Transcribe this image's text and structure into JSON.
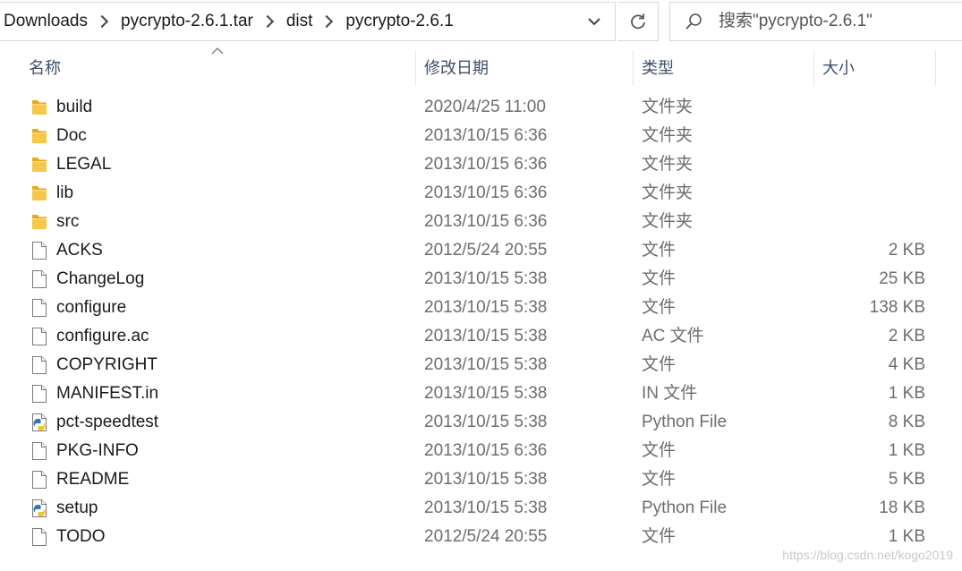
{
  "breadcrumb": [
    "Downloads",
    "pycrypto-2.6.1.tar",
    "dist",
    "pycrypto-2.6.1"
  ],
  "search": {
    "placeholder": "搜索\"pycrypto-2.6.1\""
  },
  "columns": {
    "name": "名称",
    "date": "修改日期",
    "type": "类型",
    "size": "大小"
  },
  "files": [
    {
      "name": "build",
      "date": "2020/4/25 11:00",
      "type": "文件夹",
      "size": "",
      "icon": "folder-icon"
    },
    {
      "name": "Doc",
      "date": "2013/10/15 6:36",
      "type": "文件夹",
      "size": "",
      "icon": "folder-icon"
    },
    {
      "name": "LEGAL",
      "date": "2013/10/15 6:36",
      "type": "文件夹",
      "size": "",
      "icon": "folder-icon"
    },
    {
      "name": "lib",
      "date": "2013/10/15 6:36",
      "type": "文件夹",
      "size": "",
      "icon": "folder-icon"
    },
    {
      "name": "src",
      "date": "2013/10/15 6:36",
      "type": "文件夹",
      "size": "",
      "icon": "folder-icon"
    },
    {
      "name": "ACKS",
      "date": "2012/5/24 20:55",
      "type": "文件",
      "size": "2 KB",
      "icon": "file-icon"
    },
    {
      "name": "ChangeLog",
      "date": "2013/10/15 5:38",
      "type": "文件",
      "size": "25 KB",
      "icon": "file-icon"
    },
    {
      "name": "configure",
      "date": "2013/10/15 5:38",
      "type": "文件",
      "size": "138 KB",
      "icon": "file-icon"
    },
    {
      "name": "configure.ac",
      "date": "2013/10/15 5:38",
      "type": "AC 文件",
      "size": "2 KB",
      "icon": "file-icon"
    },
    {
      "name": "COPYRIGHT",
      "date": "2013/10/15 5:38",
      "type": "文件",
      "size": "4 KB",
      "icon": "file-icon"
    },
    {
      "name": "MANIFEST.in",
      "date": "2013/10/15 5:38",
      "type": "IN 文件",
      "size": "1 KB",
      "icon": "file-icon"
    },
    {
      "name": "pct-speedtest",
      "date": "2013/10/15 5:38",
      "type": "Python File",
      "size": "8 KB",
      "icon": "python-file-icon"
    },
    {
      "name": "PKG-INFO",
      "date": "2013/10/15 6:36",
      "type": "文件",
      "size": "1 KB",
      "icon": "file-icon"
    },
    {
      "name": "README",
      "date": "2013/10/15 5:38",
      "type": "文件",
      "size": "5 KB",
      "icon": "file-icon"
    },
    {
      "name": "setup",
      "date": "2013/10/15 5:38",
      "type": "Python File",
      "size": "18 KB",
      "icon": "python-file-icon"
    },
    {
      "name": "TODO",
      "date": "2012/5/24 20:55",
      "type": "文件",
      "size": "1 KB",
      "icon": "file-icon"
    }
  ],
  "watermark": "https://blog.csdn.net/kogo2019",
  "colors": {
    "folder": "#f5c343",
    "header_text": "#3d4f6a",
    "meta_text": "#6d6d6d"
  }
}
